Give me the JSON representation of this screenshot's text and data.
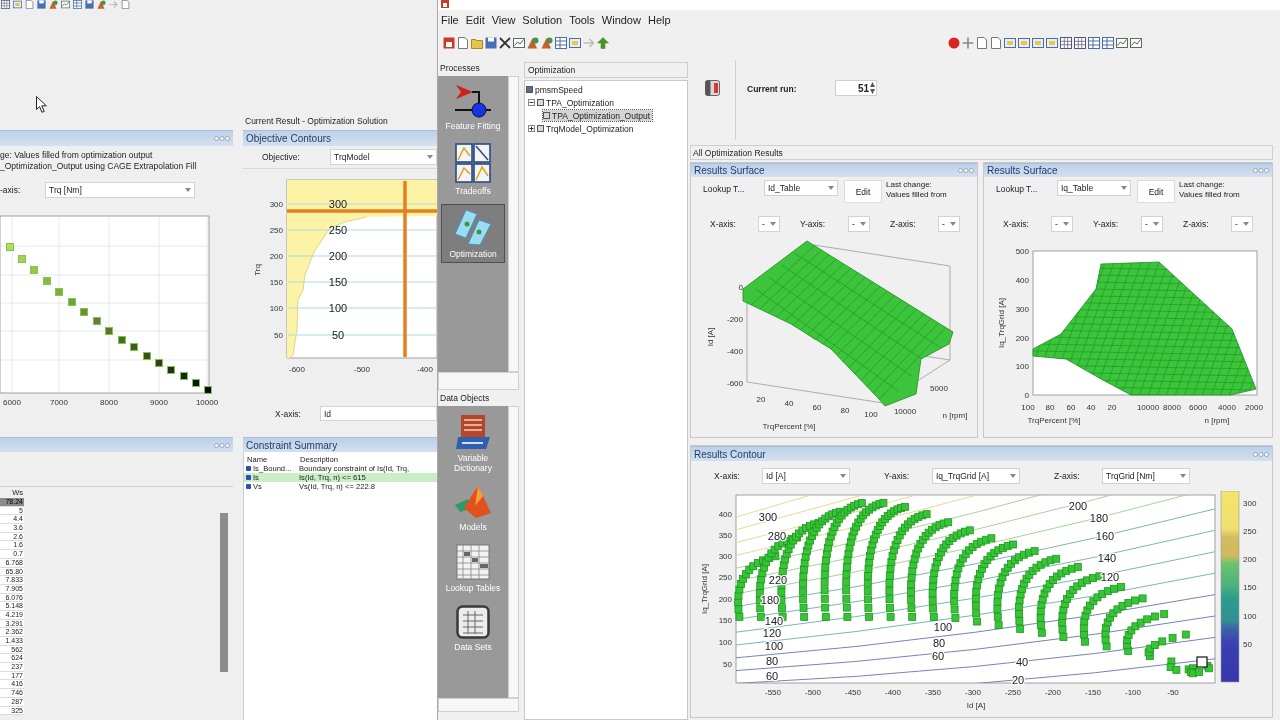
{
  "back_window": {
    "current_result_title": "Current Result - Optimization Solution",
    "fill_panel": {
      "note_lines": [
        "ge: Values filled from optimization output",
        "_Optimization_Output using CAGE Extrapolation Fill"
      ],
      "axis_label": "-axis:",
      "axis_value": "Trq [Nm]",
      "x_ticks": [
        "6000",
        "7000",
        "8000",
        "9000",
        "10000"
      ]
    },
    "objective_contours": {
      "title": "Objective Contours",
      "objective_label": "Objective:",
      "objective_value": "TrqModel",
      "y_label": "Trq",
      "y_ticks": [
        "300",
        "250",
        "200",
        "150",
        "100",
        "50"
      ],
      "contour_labels": [
        "300",
        "250",
        "200",
        "150",
        "100",
        "50"
      ],
      "x_ticks": [
        "-600",
        "-500",
        "-400"
      ],
      "x_axis_label": "X-axis:",
      "x_axis_value": "Id"
    },
    "values_table": {
      "column": "Ws",
      "rows": [
        {
          "value": "78.24",
          "selected": true
        },
        {
          "value": "5",
          "selected": false
        },
        {
          "value": "4.4",
          "selected": false
        },
        {
          "value": "3.6",
          "selected": false
        },
        {
          "value": "2.6",
          "selected": false
        },
        {
          "value": "1.6",
          "selected": false
        },
        {
          "value": "0.7",
          "selected": false
        },
        {
          "value": "6.768",
          "selected": false
        },
        {
          "value": "65.80",
          "selected": false
        },
        {
          "value": "7.833",
          "selected": false
        },
        {
          "value": "7.905",
          "selected": false
        },
        {
          "value": "6.076",
          "selected": false
        },
        {
          "value": "5.148",
          "selected": false
        },
        {
          "value": "4.219",
          "selected": false
        },
        {
          "value": "3.291",
          "selected": false
        },
        {
          "value": "2.362",
          "selected": false
        },
        {
          "value": "1.433",
          "selected": false
        },
        {
          "value": "562",
          "selected": false
        },
        {
          "value": "624",
          "selected": false
        },
        {
          "value": "237",
          "selected": false
        },
        {
          "value": "177",
          "selected": false
        },
        {
          "value": "416",
          "selected": false
        },
        {
          "value": "746",
          "selected": false
        },
        {
          "value": "287",
          "selected": false
        },
        {
          "value": "325",
          "selected": false
        }
      ]
    },
    "constraint_summary": {
      "title": "Constraint Summary",
      "columns": [
        "Name",
        "Description"
      ],
      "rows": [
        {
          "name": "Is_Bound...",
          "description": "Boundary constraint of Is(Id, Trq,",
          "selected": false
        },
        {
          "name": "Is",
          "description": "Is(Id, Trq, n) <= 615",
          "selected": true
        },
        {
          "name": "Vs",
          "description": "Vs(Id, Trq, n) <= 222.8",
          "selected": false
        }
      ]
    }
  },
  "window": {
    "menu": [
      "File",
      "Edit",
      "View",
      "Solution",
      "Tools",
      "Window",
      "Help"
    ],
    "processes": {
      "title": "Processes",
      "items": [
        {
          "label": "Feature Fitting",
          "kind": "feature-fitting",
          "selected": false
        },
        {
          "label": "Tradeoffs",
          "kind": "tradeoffs",
          "selected": false
        },
        {
          "label": "Optimization",
          "kind": "optimization",
          "selected": true
        }
      ]
    },
    "data_objects": {
      "title": "Data Objects",
      "items": [
        {
          "label": "Variable Dictionary",
          "kind": "dictionary",
          "selected": false
        },
        {
          "label": "Models",
          "kind": "models",
          "selected": false
        },
        {
          "label": "Lookup Tables",
          "kind": "lookup",
          "selected": false
        },
        {
          "label": "Data Sets",
          "kind": "datasets",
          "selected": false
        }
      ]
    },
    "tree": {
      "title": "Optimization",
      "root": {
        "label": "pmsmSpeed",
        "selected": false,
        "children": [
          {
            "label": "TPA_Optimization",
            "expanded": true,
            "selected": false,
            "children": [
              {
                "label": "TPA_Optimization_Output",
                "selected": true
              }
            ]
          },
          {
            "label": "TrqModel_Optimization",
            "expanded": false,
            "selected": false
          }
        ]
      }
    },
    "current_run": {
      "label": "Current run:",
      "value": "51"
    },
    "results_title": "All Optimization Results",
    "surfaces": [
      {
        "title": "Results Surface",
        "kind": "ridge",
        "lookup_label": "Lookup T...",
        "lookup_value": "Id_Table",
        "edit_label": "Edit",
        "last_change": [
          "Last change:",
          "Values filled from"
        ],
        "axes": [
          {
            "label": "X-axis:",
            "value": "-"
          },
          {
            "label": "Y-axis:",
            "value": "-"
          },
          {
            "label": "Z-axis:",
            "value": "-"
          }
        ],
        "vertical_label": "Id [A]",
        "vertical_ticks": [
          "0",
          "-200",
          "-400",
          "-600"
        ],
        "x_label": "TrqPercent [%]",
        "x_ticks": [
          "20",
          "40",
          "60",
          "80",
          "100"
        ],
        "depth_label": "n [rpm]",
        "depth_ticks": [
          "10000",
          "5000"
        ]
      },
      {
        "title": "Results Surface",
        "kind": "fan",
        "lookup_label": "Lookup T...",
        "lookup_value": "Iq_Table",
        "edit_label": "Edit",
        "last_change": [
          "Last change:",
          "Values filled from"
        ],
        "axes": [
          {
            "label": "X-axis:",
            "value": "-"
          },
          {
            "label": "Y-axis:",
            "value": "-"
          },
          {
            "label": "Z-axis:",
            "value": "-"
          }
        ],
        "vertical_label": "Iq_TrqGrid [A]",
        "vertical_ticks": [
          "500",
          "400",
          "300",
          "200",
          "100",
          "0"
        ],
        "x_label": "TrqPercent [%]",
        "x_ticks": [
          "100",
          "80",
          "60",
          "40",
          "20"
        ],
        "depth_label": "n [rpm]",
        "depth_ticks": [
          "10000",
          "8000",
          "6000",
          "4000",
          "2000"
        ]
      }
    ],
    "contour": {
      "title": "Results Contour",
      "axes": [
        {
          "label": "X-axis:",
          "value": "Id [A]"
        },
        {
          "label": "Y-axis:",
          "value": "Iq_TrqGrid [A]"
        },
        {
          "label": "Z-axis:",
          "value": "TrqGrid [Nm]"
        }
      ],
      "y_label": "Iq_TrqGrid [A]",
      "y_ticks": [
        "400",
        "350",
        "300",
        "250",
        "200",
        "150",
        "100",
        "50"
      ],
      "x_label": "Id [A]",
      "x_ticks": [
        "-550",
        "-500",
        "-450",
        "-400",
        "-350",
        "-300",
        "-250",
        "-200",
        "-150",
        "-100",
        "-50"
      ],
      "contour_labels": [
        "300",
        "280",
        "220",
        "180",
        "140",
        "120",
        "100",
        "80",
        "60",
        "200",
        "180",
        "160",
        "140",
        "120",
        "100",
        "80",
        "60",
        "40",
        "20"
      ],
      "colorbar_ticks": [
        "300",
        "250",
        "200",
        "150",
        "100",
        "50"
      ]
    }
  }
}
